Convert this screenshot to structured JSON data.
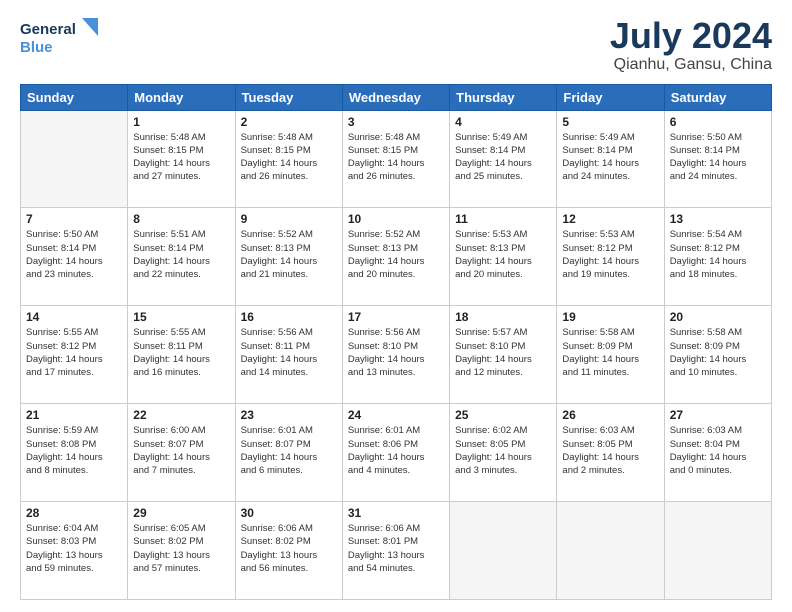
{
  "logo": {
    "line1": "General",
    "line2": "Blue"
  },
  "title": "July 2024",
  "subtitle": "Qianhu, Gansu, China",
  "weekdays": [
    "Sunday",
    "Monday",
    "Tuesday",
    "Wednesday",
    "Thursday",
    "Friday",
    "Saturday"
  ],
  "weeks": [
    [
      {
        "day": "",
        "info": ""
      },
      {
        "day": "1",
        "info": "Sunrise: 5:48 AM\nSunset: 8:15 PM\nDaylight: 14 hours\nand 27 minutes."
      },
      {
        "day": "2",
        "info": "Sunrise: 5:48 AM\nSunset: 8:15 PM\nDaylight: 14 hours\nand 26 minutes."
      },
      {
        "day": "3",
        "info": "Sunrise: 5:48 AM\nSunset: 8:15 PM\nDaylight: 14 hours\nand 26 minutes."
      },
      {
        "day": "4",
        "info": "Sunrise: 5:49 AM\nSunset: 8:14 PM\nDaylight: 14 hours\nand 25 minutes."
      },
      {
        "day": "5",
        "info": "Sunrise: 5:49 AM\nSunset: 8:14 PM\nDaylight: 14 hours\nand 24 minutes."
      },
      {
        "day": "6",
        "info": "Sunrise: 5:50 AM\nSunset: 8:14 PM\nDaylight: 14 hours\nand 24 minutes."
      }
    ],
    [
      {
        "day": "7",
        "info": "Sunrise: 5:50 AM\nSunset: 8:14 PM\nDaylight: 14 hours\nand 23 minutes."
      },
      {
        "day": "8",
        "info": "Sunrise: 5:51 AM\nSunset: 8:14 PM\nDaylight: 14 hours\nand 22 minutes."
      },
      {
        "day": "9",
        "info": "Sunrise: 5:52 AM\nSunset: 8:13 PM\nDaylight: 14 hours\nand 21 minutes."
      },
      {
        "day": "10",
        "info": "Sunrise: 5:52 AM\nSunset: 8:13 PM\nDaylight: 14 hours\nand 20 minutes."
      },
      {
        "day": "11",
        "info": "Sunrise: 5:53 AM\nSunset: 8:13 PM\nDaylight: 14 hours\nand 20 minutes."
      },
      {
        "day": "12",
        "info": "Sunrise: 5:53 AM\nSunset: 8:12 PM\nDaylight: 14 hours\nand 19 minutes."
      },
      {
        "day": "13",
        "info": "Sunrise: 5:54 AM\nSunset: 8:12 PM\nDaylight: 14 hours\nand 18 minutes."
      }
    ],
    [
      {
        "day": "14",
        "info": "Sunrise: 5:55 AM\nSunset: 8:12 PM\nDaylight: 14 hours\nand 17 minutes."
      },
      {
        "day": "15",
        "info": "Sunrise: 5:55 AM\nSunset: 8:11 PM\nDaylight: 14 hours\nand 16 minutes."
      },
      {
        "day": "16",
        "info": "Sunrise: 5:56 AM\nSunset: 8:11 PM\nDaylight: 14 hours\nand 14 minutes."
      },
      {
        "day": "17",
        "info": "Sunrise: 5:56 AM\nSunset: 8:10 PM\nDaylight: 14 hours\nand 13 minutes."
      },
      {
        "day": "18",
        "info": "Sunrise: 5:57 AM\nSunset: 8:10 PM\nDaylight: 14 hours\nand 12 minutes."
      },
      {
        "day": "19",
        "info": "Sunrise: 5:58 AM\nSunset: 8:09 PM\nDaylight: 14 hours\nand 11 minutes."
      },
      {
        "day": "20",
        "info": "Sunrise: 5:58 AM\nSunset: 8:09 PM\nDaylight: 14 hours\nand 10 minutes."
      }
    ],
    [
      {
        "day": "21",
        "info": "Sunrise: 5:59 AM\nSunset: 8:08 PM\nDaylight: 14 hours\nand 8 minutes."
      },
      {
        "day": "22",
        "info": "Sunrise: 6:00 AM\nSunset: 8:07 PM\nDaylight: 14 hours\nand 7 minutes."
      },
      {
        "day": "23",
        "info": "Sunrise: 6:01 AM\nSunset: 8:07 PM\nDaylight: 14 hours\nand 6 minutes."
      },
      {
        "day": "24",
        "info": "Sunrise: 6:01 AM\nSunset: 8:06 PM\nDaylight: 14 hours\nand 4 minutes."
      },
      {
        "day": "25",
        "info": "Sunrise: 6:02 AM\nSunset: 8:05 PM\nDaylight: 14 hours\nand 3 minutes."
      },
      {
        "day": "26",
        "info": "Sunrise: 6:03 AM\nSunset: 8:05 PM\nDaylight: 14 hours\nand 2 minutes."
      },
      {
        "day": "27",
        "info": "Sunrise: 6:03 AM\nSunset: 8:04 PM\nDaylight: 14 hours\nand 0 minutes."
      }
    ],
    [
      {
        "day": "28",
        "info": "Sunrise: 6:04 AM\nSunset: 8:03 PM\nDaylight: 13 hours\nand 59 minutes."
      },
      {
        "day": "29",
        "info": "Sunrise: 6:05 AM\nSunset: 8:02 PM\nDaylight: 13 hours\nand 57 minutes."
      },
      {
        "day": "30",
        "info": "Sunrise: 6:06 AM\nSunset: 8:02 PM\nDaylight: 13 hours\nand 56 minutes."
      },
      {
        "day": "31",
        "info": "Sunrise: 6:06 AM\nSunset: 8:01 PM\nDaylight: 13 hours\nand 54 minutes."
      },
      {
        "day": "",
        "info": ""
      },
      {
        "day": "",
        "info": ""
      },
      {
        "day": "",
        "info": ""
      }
    ]
  ]
}
